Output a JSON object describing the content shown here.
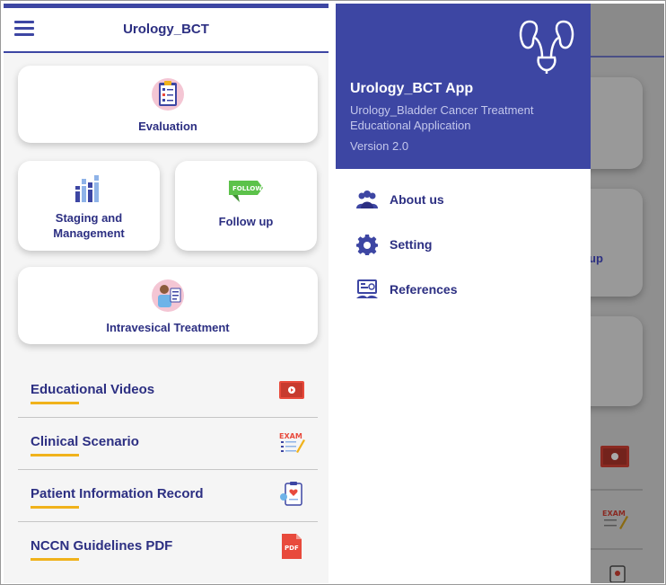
{
  "left_screen": {
    "app_title": "Urology_BCT",
    "cards": {
      "evaluation": "Evaluation",
      "staging_line1": "Staging and",
      "staging_line2": "Management",
      "follow_up": "Follow up",
      "follow_badge": "FOLLOW",
      "intravesical": "Intravesical Treatment"
    },
    "list": [
      {
        "label": "Educational Videos",
        "icon": "video-icon"
      },
      {
        "label": "Clinical Scenario",
        "icon": "exam-icon"
      },
      {
        "label": "Patient Information Record",
        "icon": "patient-record-icon"
      },
      {
        "label": "NCCN Guidelines PDF",
        "icon": "pdf-icon"
      }
    ],
    "exam_text": "EXAM",
    "pdf_text": "PDF"
  },
  "drawer": {
    "title": "Urology_BCT App",
    "subtitle": "Urology_Bladder Cancer Treatment Educational Application",
    "version": "Version 2.0",
    "items": [
      {
        "label": "About us",
        "icon": "users-icon"
      },
      {
        "label": "Setting",
        "icon": "gear-icon"
      },
      {
        "label": "References",
        "icon": "references-icon"
      }
    ]
  },
  "background_screen": {
    "partial_label": "up",
    "exam_text": "EXAM"
  },
  "colors": {
    "primary": "#3d46a3",
    "text": "#2c2f82",
    "accent": "#f0b21b",
    "pdf": "#e84a3c"
  }
}
